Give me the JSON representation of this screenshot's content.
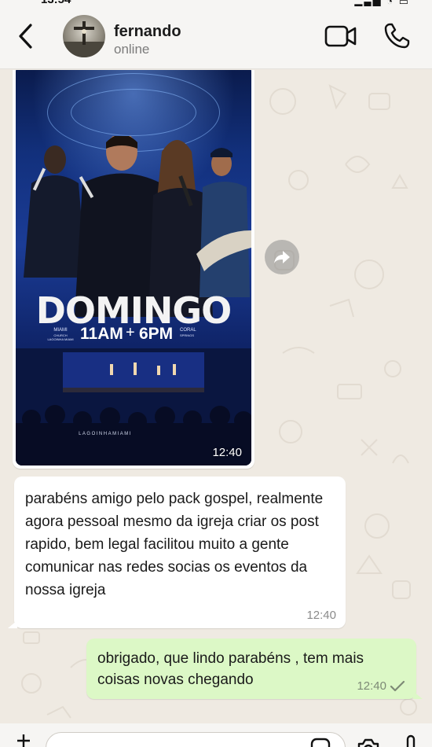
{
  "status_bar": {
    "time": "13:54",
    "system_icons": "signal-wifi-battery"
  },
  "header": {
    "back_icon": "chevron-left-icon",
    "contact_name": "fernando",
    "contact_status": "online",
    "video_icon": "video-camera-icon",
    "call_icon": "phone-icon"
  },
  "messages": [
    {
      "type": "image",
      "direction": "incoming",
      "time": "12:40",
      "poster": {
        "title": "DOMINGO",
        "time_left": "11AM",
        "time_right": "6PM",
        "location_left": "MIAMI",
        "location_left_sub": "CHURCH LAGOINHA MIAMI",
        "location_right": "CORAL",
        "location_right_sub": "SPRINGS",
        "footer": "LAGOINHAMIAMI"
      }
    },
    {
      "type": "text",
      "direction": "incoming",
      "text": "parabéns amigo pelo pack gospel, realmente agora pessoal mesmo da igreja criar os post rapido, bem legal facilitou muito a gente comunicar nas redes socias os eventos da nossa igreja",
      "time": "12:40"
    },
    {
      "type": "text",
      "direction": "outgoing",
      "text": "obrigado, que lindo parabéns , tem mais coisas novas chegando",
      "time": "12:40",
      "status_icon": "single-check-icon"
    }
  ],
  "colors": {
    "chat_background": "#efeae2",
    "incoming_bubble": "#ffffff",
    "outgoing_bubble": "#dcf8c6",
    "header_background": "#f6f5f3"
  }
}
